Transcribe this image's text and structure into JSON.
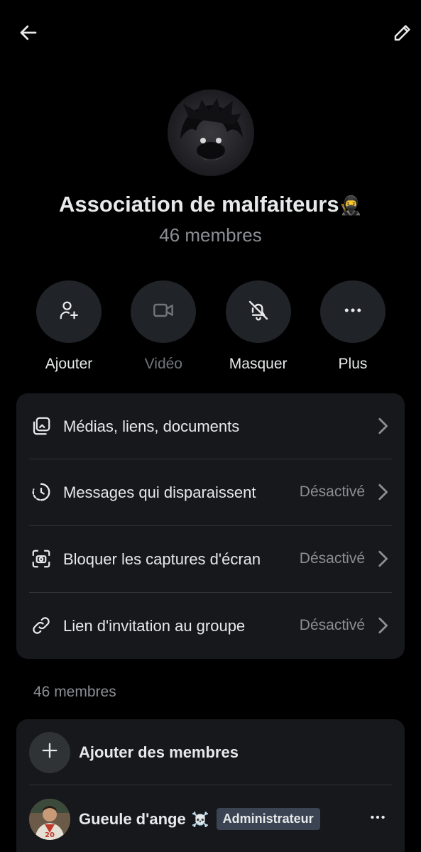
{
  "group": {
    "name": "Association de malfaiteurs",
    "name_emoji": "🥷",
    "member_count_label": "46 membres"
  },
  "actions": [
    {
      "label": "Ajouter",
      "icon": "add-user-icon",
      "enabled": true
    },
    {
      "label": "Vidéo",
      "icon": "video-icon",
      "enabled": false
    },
    {
      "label": "Masquer",
      "icon": "bell-off-icon",
      "enabled": true
    },
    {
      "label": "Plus",
      "icon": "more-icon",
      "enabled": true
    }
  ],
  "settings": [
    {
      "label": "Médias, liens, documents",
      "status": "",
      "icon": "media-icon"
    },
    {
      "label": "Messages qui disparaissent",
      "status": "Désactivé",
      "icon": "timer-icon"
    },
    {
      "label": "Bloquer les captures d'écran",
      "status": "Désactivé",
      "icon": "camera-icon"
    },
    {
      "label": "Lien d'invitation au groupe",
      "status": "Désactivé",
      "icon": "link-icon"
    }
  ],
  "members_section": {
    "title": "46 membres",
    "add_label": "Ajouter des membres",
    "members": [
      {
        "name": "Gueule d'ange",
        "emoji": "☠️",
        "badge": "Administrateur"
      }
    ]
  },
  "colors": {
    "background": "#000000",
    "card": "#16181c",
    "button": "#202327",
    "text": "#e7e9ea",
    "muted": "#8b8f94",
    "badge": "#3a4452"
  }
}
